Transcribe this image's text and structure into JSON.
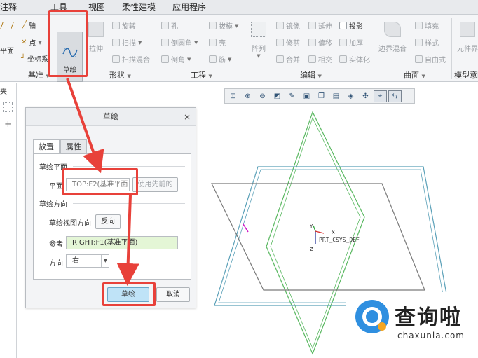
{
  "menubar": {
    "items": [
      "注释",
      "工具",
      "视图",
      "柔性建模",
      "应用程序"
    ]
  },
  "ribbon": {
    "datum": {
      "title": "基准",
      "plane": "平面",
      "axis": "轴",
      "point": "点",
      "csys": "坐标系"
    },
    "sketch": {
      "label": "草绘"
    },
    "shapes": {
      "title": "形状",
      "extrude": "拉伸",
      "revolve": "旋转",
      "sweep": "扫描",
      "swept_blend": "扫描混合"
    },
    "engineering": {
      "title": "工程",
      "hole": "孔",
      "draft": "拔模",
      "round": "倒圆角",
      "shell": "壳",
      "chamfer": "倒角",
      "rib": "筋"
    },
    "editing": {
      "title": "编辑",
      "pattern": "阵列",
      "mirror": "镜像",
      "extend": "延伸",
      "project": "投影",
      "trim": "修剪",
      "offset": "偏移",
      "thicken": "加厚",
      "merge": "合并",
      "intersect": "相交",
      "solidify": "实体化"
    },
    "surfaces": {
      "title": "曲面",
      "boundary_blend": "边界混合",
      "fill": "填充",
      "style": "样式",
      "freestyle": "自由式"
    },
    "model_intent": {
      "title": "模型意图",
      "component": "元件界"
    }
  },
  "left_panel": {
    "tab": "夹"
  },
  "view_toolbar": {
    "icons": [
      "zoom-box-icon",
      "zoom-in-icon",
      "zoom-out-icon",
      "refit-icon",
      "repaint-icon",
      "display-style-icon",
      "saved-views-icon",
      "datum-display-icon",
      "annotation-display-icon",
      "spin-center-icon",
      "sketch-view-icon",
      "sketch-orient-icon"
    ]
  },
  "dialog": {
    "title": "草绘",
    "close": "×",
    "tabs": [
      "放置",
      "属性"
    ],
    "sketch_plane_section": "草绘平面",
    "plane_label": "平面",
    "plane_value": "TOP:F2(基准平面",
    "use_previous": "使用先前的",
    "orientation_section": "草绘方向",
    "view_direction_label": "草绘视图方向",
    "flip_button": "反向",
    "reference_label": "参考",
    "reference_value": "RIGHT:F1(基准平面)",
    "orientation_label": "方向",
    "orientation_value": "右",
    "ok_button": "草绘",
    "cancel_button": "取消"
  },
  "viewport": {
    "csys_label": "PRT_CSYS_DEF",
    "axis_x": "X",
    "axis_y": "Y",
    "axis_z": "Z"
  },
  "watermark": {
    "logo_text": "查询啦",
    "url": "chaxunla.com"
  },
  "colors": {
    "highlight": "#e8413a",
    "cyan": "#5aa0b8",
    "green": "#59b860",
    "gray": "#7a7a7a",
    "ok_button": "#bfe3f7",
    "reference_field": "#e4f6d6"
  }
}
